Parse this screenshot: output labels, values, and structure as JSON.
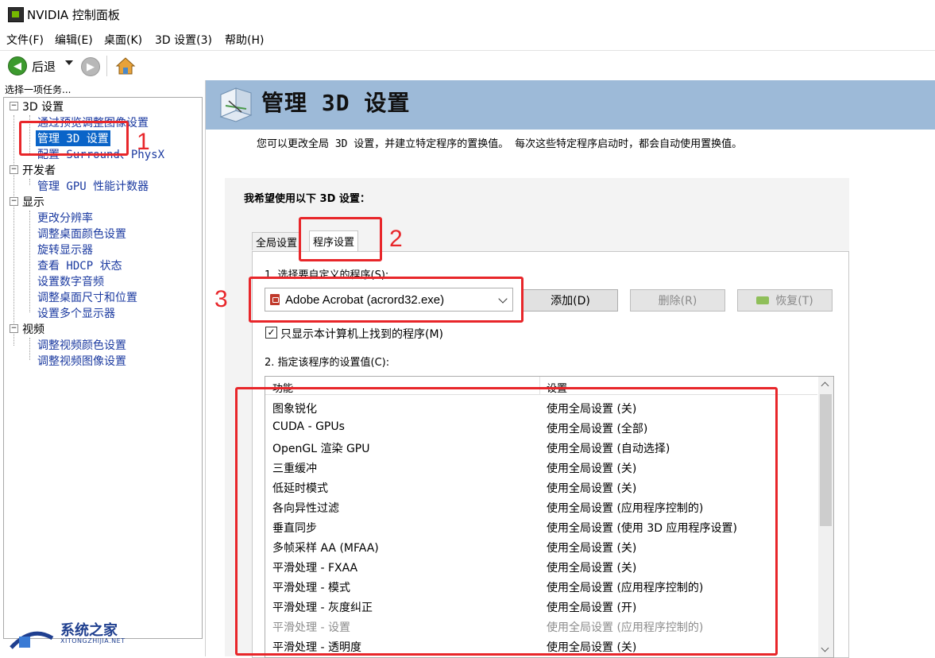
{
  "window": {
    "title": "NVIDIA 控制面板"
  },
  "menu": [
    "文件(F)",
    "编辑(E)",
    "桌面(K)",
    "3D 设置(3)",
    "帮助(H)"
  ],
  "toolbar": {
    "back_label": "后退"
  },
  "left": {
    "header": "选择一项任务...",
    "tree": [
      {
        "label": "3D 设置",
        "children": [
          "通过预览调整图像设置",
          "管理 3D 设置",
          "配置 Surround、PhysX"
        ]
      },
      {
        "label": "开发者",
        "children": [
          "管理 GPU 性能计数器"
        ]
      },
      {
        "label": "显示",
        "children": [
          "更改分辨率",
          "调整桌面颜色设置",
          "旋转显示器",
          "查看 HDCP 状态",
          "设置数字音频",
          "调整桌面尺寸和位置",
          "设置多个显示器"
        ]
      },
      {
        "label": "视频",
        "children": [
          "调整视频颜色设置",
          "调整视频图像设置"
        ]
      }
    ],
    "selected": "管理 3D 设置"
  },
  "page": {
    "title": "管理 3D 设置",
    "description": "您可以更改全局 3D 设置，并建立特定程序的置换值。 每次这些特定程序启动时，都会自动使用置换值。",
    "section_label": "我希望使用以下 3D 设置：",
    "tabs": [
      "全局设置",
      "程序设置"
    ],
    "active_tab": "程序设置",
    "step1_label": "1. 选择要自定义的程序(S):",
    "program_selected": "Adobe Acrobat (acrord32.exe)",
    "buttons": {
      "add": "添加(D)",
      "remove": "删除(R)",
      "restore": "恢复(T)"
    },
    "checkbox_label": "只显示本计算机上找到的程序(M)",
    "checkbox_checked": true,
    "step2_label": "2. 指定该程序的设置值(C):",
    "table": {
      "headers": [
        "功能",
        "设置"
      ],
      "rows": [
        [
          "图象锐化",
          "使用全局设置 (关)"
        ],
        [
          "CUDA - GPUs",
          "使用全局设置 (全部)"
        ],
        [
          "OpenGL 渲染 GPU",
          "使用全局设置 (自动选择)"
        ],
        [
          "三重缓冲",
          "使用全局设置 (关)"
        ],
        [
          "低延时模式",
          "使用全局设置 (关)"
        ],
        [
          "各向异性过滤",
          "使用全局设置 (应用程序控制的)"
        ],
        [
          "垂直同步",
          "使用全局设置 (使用 3D 应用程序设置)"
        ],
        [
          "多帧采样 AA (MFAA)",
          "使用全局设置 (关)"
        ],
        [
          "平滑处理 - FXAA",
          "使用全局设置 (关)"
        ],
        [
          "平滑处理 - 模式",
          "使用全局设置 (应用程序控制的)"
        ],
        [
          "平滑处理 - 灰度纠正",
          "使用全局设置 (开)"
        ],
        [
          "平滑处理 - 设置",
          "使用全局设置 (应用程序控制的)"
        ],
        [
          "平滑处理 - 透明度",
          "使用全局设置 (关)"
        ]
      ]
    }
  },
  "annotations": [
    "1",
    "2",
    "3"
  ],
  "watermark": {
    "name": "系统之家",
    "url": "XITONGZHIJIA.NET"
  },
  "colors": {
    "banner": "#9dbad8",
    "selection": "#0a64c8",
    "annotation": "#e8262a",
    "link": "#1b3aa0"
  }
}
